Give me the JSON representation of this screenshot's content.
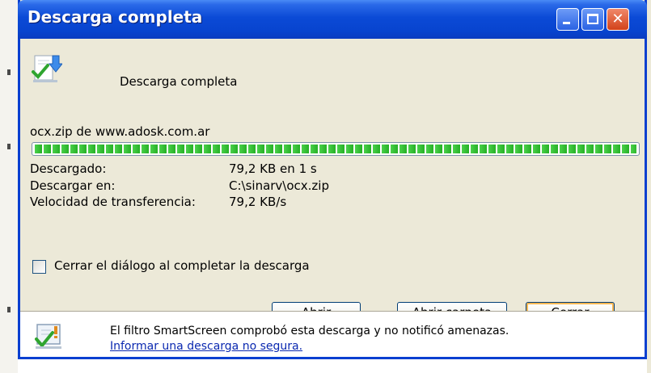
{
  "window": {
    "title": "Descarga completa"
  },
  "header": {
    "icon": "download-complete-icon",
    "message": "Descarga completa"
  },
  "download": {
    "file_line": "ocx.zip de www.adosk.com.ar",
    "progress": 1.0,
    "details": [
      {
        "label": "Descargado:",
        "value": "79,2 KB en 1 s"
      },
      {
        "label": "Descargar en:",
        "value": "C:\\sinarv\\ocx.zip"
      },
      {
        "label": "Velocidad de transferencia:",
        "value": "79,2 KB/s"
      }
    ]
  },
  "options": {
    "close_on_complete_label": "Cerrar el diálogo al completar la descarga",
    "close_on_complete_checked": false
  },
  "buttons": {
    "open": "Abrir",
    "open_folder": "Abrir carpeta",
    "close": "Cerrar"
  },
  "footer": {
    "icon": "smartscreen-check-icon",
    "message": "El filtro SmartScreen comprobó esta descarga y no notificó amenazas.",
    "link": "Informar una descarga no segura."
  },
  "colors": {
    "titlebar": "#0b4ad6",
    "dialog_bg": "#ece9d8",
    "progress_fill": "#26b026",
    "link": "#0a28b0"
  }
}
